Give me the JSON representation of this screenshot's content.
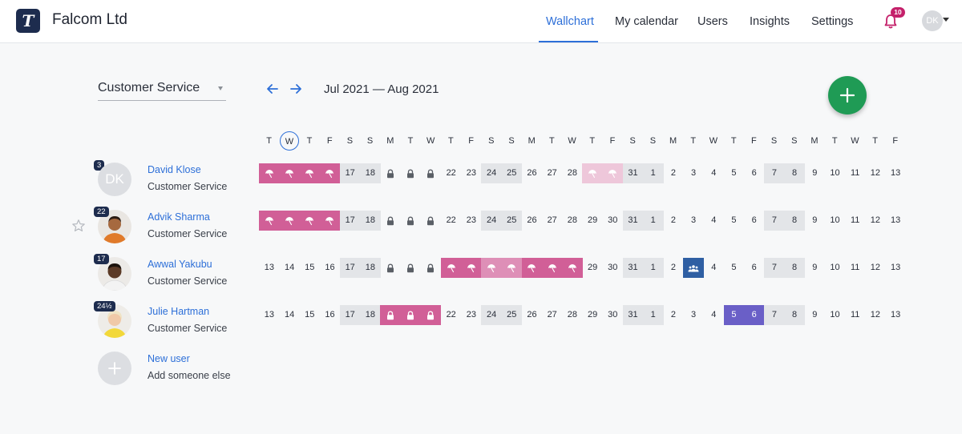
{
  "header": {
    "logo_letter": "T",
    "company": "Falcom Ltd",
    "nav": [
      "Wallchart",
      "My calendar",
      "Users",
      "Insights",
      "Settings"
    ],
    "active_nav": "Wallchart",
    "notification_count": "10",
    "user_initials": "DK"
  },
  "controls": {
    "team": "Customer Service",
    "date_range": "Jul 2021 — Aug 2021"
  },
  "day_headers": [
    "T",
    "W",
    "T",
    "F",
    "S",
    "S",
    "M",
    "T",
    "W",
    "T",
    "F",
    "S",
    "S",
    "M",
    "T",
    "W",
    "T",
    "F",
    "S",
    "S",
    "M",
    "T",
    "W",
    "T",
    "F",
    "S",
    "S",
    "M",
    "T",
    "W",
    "T",
    "F"
  ],
  "today_index": 1,
  "colors": {
    "accent": "#2d6fd8",
    "vacation": "#d15f97",
    "vacation_light": "#eec7da",
    "vacation_mid": "#de8fb7",
    "weekend": "#e3e5e8",
    "lock": "#5a5f66",
    "meeting": "#2f5fa3",
    "other_leave": "#6a5fc7",
    "fab": "#1f9b55"
  },
  "users": [
    {
      "name": "David Klose",
      "team": "Customer Service",
      "count": "3",
      "initials": "DK",
      "photo": "initials",
      "days": [
        {
          "t": "icon",
          "k": "umbrella",
          "bg": "vacation"
        },
        {
          "t": "icon",
          "k": "umbrella",
          "bg": "vacation"
        },
        {
          "t": "icon",
          "k": "umbrella",
          "bg": "vacation"
        },
        {
          "t": "icon",
          "k": "umbrella",
          "bg": "vacation"
        },
        {
          "t": "num",
          "v": "17",
          "bg": "weekend"
        },
        {
          "t": "num",
          "v": "18",
          "bg": "weekend"
        },
        {
          "t": "icon",
          "k": "lock"
        },
        {
          "t": "icon",
          "k": "lock"
        },
        {
          "t": "icon",
          "k": "lock"
        },
        {
          "t": "num",
          "v": "22"
        },
        {
          "t": "num",
          "v": "23"
        },
        {
          "t": "num",
          "v": "24",
          "bg": "weekend"
        },
        {
          "t": "num",
          "v": "25",
          "bg": "weekend"
        },
        {
          "t": "num",
          "v": "26"
        },
        {
          "t": "num",
          "v": "27"
        },
        {
          "t": "num",
          "v": "28"
        },
        {
          "t": "icon",
          "k": "umbrella",
          "bg": "vacation_light"
        },
        {
          "t": "icon",
          "k": "umbrella",
          "bg": "vacation_light"
        },
        {
          "t": "num",
          "v": "31",
          "bg": "weekend"
        },
        {
          "t": "num",
          "v": "1",
          "bg": "weekend"
        },
        {
          "t": "num",
          "v": "2"
        },
        {
          "t": "num",
          "v": "3"
        },
        {
          "t": "num",
          "v": "4"
        },
        {
          "t": "num",
          "v": "5"
        },
        {
          "t": "num",
          "v": "6"
        },
        {
          "t": "num",
          "v": "7",
          "bg": "weekend"
        },
        {
          "t": "num",
          "v": "8",
          "bg": "weekend"
        },
        {
          "t": "num",
          "v": "9"
        },
        {
          "t": "num",
          "v": "10"
        },
        {
          "t": "num",
          "v": "11"
        },
        {
          "t": "num",
          "v": "12"
        },
        {
          "t": "num",
          "v": "13"
        }
      ]
    },
    {
      "name": "Advik Sharma",
      "team": "Customer Service",
      "count": "22",
      "photo": "orange",
      "days": [
        {
          "t": "icon",
          "k": "umbrella",
          "bg": "vacation"
        },
        {
          "t": "icon",
          "k": "umbrella",
          "bg": "vacation"
        },
        {
          "t": "icon",
          "k": "umbrella",
          "bg": "vacation"
        },
        {
          "t": "icon",
          "k": "umbrella",
          "bg": "vacation"
        },
        {
          "t": "num",
          "v": "17",
          "bg": "weekend"
        },
        {
          "t": "num",
          "v": "18",
          "bg": "weekend"
        },
        {
          "t": "icon",
          "k": "lock"
        },
        {
          "t": "icon",
          "k": "lock"
        },
        {
          "t": "icon",
          "k": "lock"
        },
        {
          "t": "num",
          "v": "22"
        },
        {
          "t": "num",
          "v": "23"
        },
        {
          "t": "num",
          "v": "24",
          "bg": "weekend"
        },
        {
          "t": "num",
          "v": "25",
          "bg": "weekend"
        },
        {
          "t": "num",
          "v": "26"
        },
        {
          "t": "num",
          "v": "27"
        },
        {
          "t": "num",
          "v": "28"
        },
        {
          "t": "num",
          "v": "29"
        },
        {
          "t": "num",
          "v": "30"
        },
        {
          "t": "num",
          "v": "31",
          "bg": "weekend"
        },
        {
          "t": "num",
          "v": "1",
          "bg": "weekend"
        },
        {
          "t": "num",
          "v": "2"
        },
        {
          "t": "num",
          "v": "3"
        },
        {
          "t": "num",
          "v": "4"
        },
        {
          "t": "num",
          "v": "5"
        },
        {
          "t": "num",
          "v": "6"
        },
        {
          "t": "num",
          "v": "7",
          "bg": "weekend"
        },
        {
          "t": "num",
          "v": "8",
          "bg": "weekend"
        },
        {
          "t": "num",
          "v": "9"
        },
        {
          "t": "num",
          "v": "10"
        },
        {
          "t": "num",
          "v": "11"
        },
        {
          "t": "num",
          "v": "12"
        },
        {
          "t": "num",
          "v": "13"
        }
      ]
    },
    {
      "name": "Awwal Yakubu",
      "team": "Customer Service",
      "count": "17",
      "photo": "white",
      "days": [
        {
          "t": "num",
          "v": "13"
        },
        {
          "t": "num",
          "v": "14"
        },
        {
          "t": "num",
          "v": "15"
        },
        {
          "t": "num",
          "v": "16"
        },
        {
          "t": "num",
          "v": "17",
          "bg": "weekend"
        },
        {
          "t": "num",
          "v": "18",
          "bg": "weekend"
        },
        {
          "t": "icon",
          "k": "lock"
        },
        {
          "t": "icon",
          "k": "lock"
        },
        {
          "t": "icon",
          "k": "lock"
        },
        {
          "t": "icon",
          "k": "umbrella",
          "bg": "vacation"
        },
        {
          "t": "icon",
          "k": "umbrella",
          "bg": "vacation"
        },
        {
          "t": "icon",
          "k": "umbrella",
          "bg": "vacation_mid"
        },
        {
          "t": "icon",
          "k": "umbrella",
          "bg": "vacation_mid"
        },
        {
          "t": "icon",
          "k": "umbrella",
          "bg": "vacation"
        },
        {
          "t": "icon",
          "k": "umbrella",
          "bg": "vacation"
        },
        {
          "t": "icon",
          "k": "umbrella",
          "bg": "vacation"
        },
        {
          "t": "num",
          "v": "29"
        },
        {
          "t": "num",
          "v": "30"
        },
        {
          "t": "num",
          "v": "31",
          "bg": "weekend"
        },
        {
          "t": "num",
          "v": "1",
          "bg": "weekend"
        },
        {
          "t": "num",
          "v": "2"
        },
        {
          "t": "icon",
          "k": "people",
          "bg": "meeting"
        },
        {
          "t": "num",
          "v": "4"
        },
        {
          "t": "num",
          "v": "5"
        },
        {
          "t": "num",
          "v": "6"
        },
        {
          "t": "num",
          "v": "7",
          "bg": "weekend"
        },
        {
          "t": "num",
          "v": "8",
          "bg": "weekend"
        },
        {
          "t": "num",
          "v": "9"
        },
        {
          "t": "num",
          "v": "10"
        },
        {
          "t": "num",
          "v": "11"
        },
        {
          "t": "num",
          "v": "12"
        },
        {
          "t": "num",
          "v": "13"
        }
      ]
    },
    {
      "name": "Julie Hartman",
      "team": "Customer Service",
      "count": "24½",
      "photo": "yellow",
      "days": [
        {
          "t": "num",
          "v": "13"
        },
        {
          "t": "num",
          "v": "14"
        },
        {
          "t": "num",
          "v": "15"
        },
        {
          "t": "num",
          "v": "16"
        },
        {
          "t": "num",
          "v": "17",
          "bg": "weekend"
        },
        {
          "t": "num",
          "v": "18",
          "bg": "weekend"
        },
        {
          "t": "icon",
          "k": "lock",
          "bg": "vacation"
        },
        {
          "t": "icon",
          "k": "lock",
          "bg": "vacation"
        },
        {
          "t": "icon",
          "k": "lock",
          "bg": "vacation"
        },
        {
          "t": "num",
          "v": "22"
        },
        {
          "t": "num",
          "v": "23"
        },
        {
          "t": "num",
          "v": "24",
          "bg": "weekend"
        },
        {
          "t": "num",
          "v": "25",
          "bg": "weekend"
        },
        {
          "t": "num",
          "v": "26"
        },
        {
          "t": "num",
          "v": "27"
        },
        {
          "t": "num",
          "v": "28"
        },
        {
          "t": "num",
          "v": "29"
        },
        {
          "t": "num",
          "v": "30"
        },
        {
          "t": "num",
          "v": "31",
          "bg": "weekend"
        },
        {
          "t": "num",
          "v": "1",
          "bg": "weekend"
        },
        {
          "t": "num",
          "v": "2"
        },
        {
          "t": "num",
          "v": "3"
        },
        {
          "t": "num",
          "v": "4"
        },
        {
          "t": "num",
          "v": "5",
          "bg": "other_leave"
        },
        {
          "t": "num",
          "v": "6",
          "bg": "other_leave"
        },
        {
          "t": "num",
          "v": "7",
          "bg": "weekend"
        },
        {
          "t": "num",
          "v": "8",
          "bg": "weekend"
        },
        {
          "t": "num",
          "v": "9"
        },
        {
          "t": "num",
          "v": "10"
        },
        {
          "t": "num",
          "v": "11"
        },
        {
          "t": "num",
          "v": "12"
        },
        {
          "t": "num",
          "v": "13"
        }
      ]
    }
  ],
  "new_user": {
    "name": "New user",
    "subtitle": "Add someone else"
  }
}
